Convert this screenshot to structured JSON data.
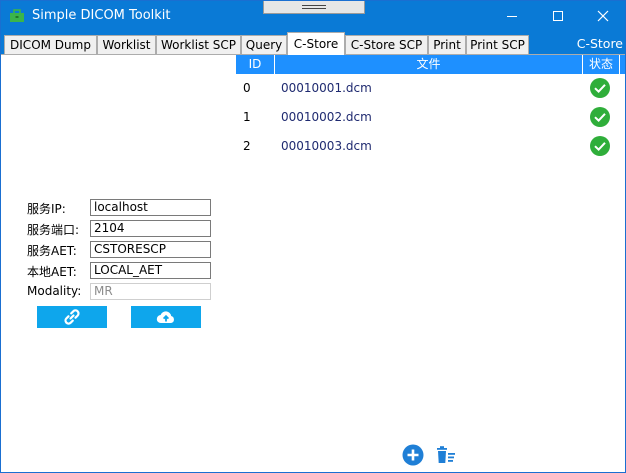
{
  "window": {
    "title": "Simple DICOM Toolkit"
  },
  "tabs": [
    {
      "label": "DICOM Dump"
    },
    {
      "label": "Worklist"
    },
    {
      "label": "Worklist SCP"
    },
    {
      "label": "Query"
    },
    {
      "label": "C-Store",
      "active": true
    },
    {
      "label": "C-Store SCP"
    },
    {
      "label": "Print"
    },
    {
      "label": "Print SCP"
    }
  ],
  "tab_caption": "C-Store",
  "table": {
    "headers": {
      "id": "ID",
      "file": "文件",
      "status": "状态"
    },
    "rows": [
      {
        "id": "0",
        "file": "00010001.dcm",
        "status": "success"
      },
      {
        "id": "1",
        "file": "00010002.dcm",
        "status": "success"
      },
      {
        "id": "2",
        "file": "00010003.dcm",
        "status": "success"
      }
    ]
  },
  "form": {
    "server_ip": {
      "label": "服务IP:",
      "value": "localhost"
    },
    "server_port": {
      "label": "服务端口:",
      "value": "2104"
    },
    "server_aet": {
      "label": "服务AET:",
      "value": "CSTORESCP"
    },
    "local_aet": {
      "label": "本地AET:",
      "value": "LOCAL_AET"
    },
    "modality": {
      "label": "Modality:",
      "value": "MR"
    }
  },
  "colors": {
    "titlebar": "#0a7ad6",
    "header": "#1e90ff",
    "action_button": "#0ea6ec",
    "success": "#2fae3a",
    "bottom_icon": "#1f7fd6"
  },
  "icons": {
    "app": "toolbox-icon",
    "connect": "link-icon",
    "send": "cloud-upload-icon",
    "add": "plus-circle-icon",
    "delete": "trash-list-icon",
    "status": "check-circle-icon"
  }
}
